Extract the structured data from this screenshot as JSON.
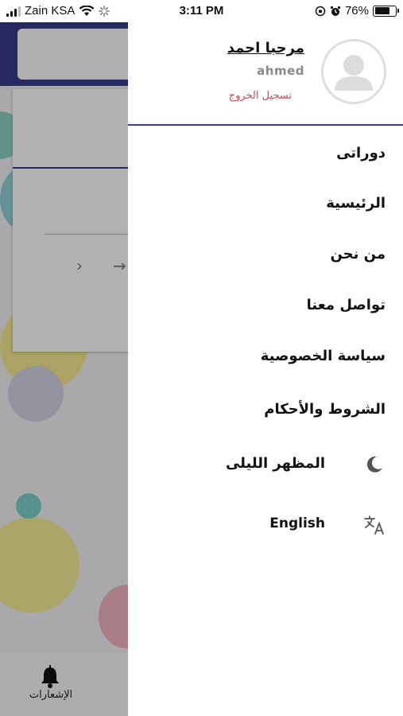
{
  "status_bar": {
    "carrier": "Zain KSA",
    "time": "3:11 PM",
    "battery_percent": "76%",
    "battery_level": 0.76
  },
  "drawer": {
    "greeting": "مرحبا احمد",
    "username": "ahmed",
    "logout_label": "تسجيل الخروج",
    "menu": [
      {
        "label": "دوراتى"
      },
      {
        "label": "الرئيسية"
      },
      {
        "label": "من نحن"
      },
      {
        "label": "تواصل معنا"
      },
      {
        "label": "سياسة الخصوصية"
      },
      {
        "label": "الشروط والأحكام"
      }
    ],
    "dark_mode_label": "المظهر الليلى",
    "language_label": "English",
    "icons": {
      "avatar": "user-avatar-icon",
      "dark_mode": "moon-icon",
      "language": "translate-icon"
    }
  },
  "background": {
    "notifications_label": "الإشعارات",
    "icons": {
      "notifications": "bell-icon"
    }
  },
  "colors": {
    "accent": "#3a3c8e",
    "logout": "#e0414a"
  }
}
